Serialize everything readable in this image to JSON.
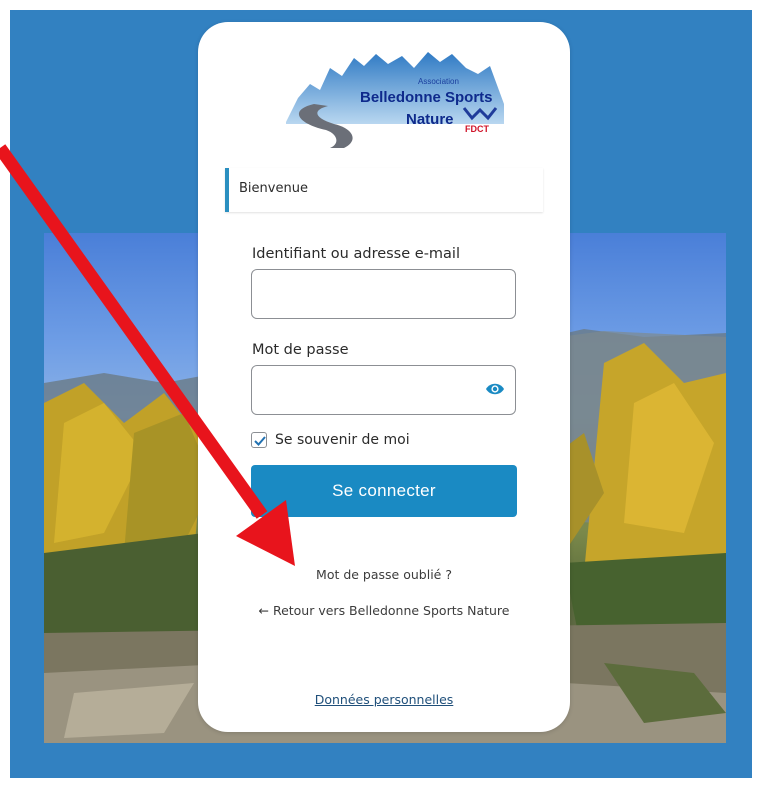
{
  "logo": {
    "line1": "Association",
    "line2": "Belledonne Sports",
    "line3": "Nature",
    "badge": "FDCT"
  },
  "notice": {
    "text": "Bienvenue"
  },
  "form": {
    "username_label": "Identifiant ou adresse e-mail",
    "username_value": "",
    "password_label": "Mot de passe",
    "password_value": "",
    "remember_label": "Se souvenir de moi",
    "remember_checked": true,
    "submit_label": "Se connecter"
  },
  "links": {
    "lost_password": "Mot de passe oublié ?",
    "back_to_site": "← Retour vers Belledonne Sports Nature",
    "privacy": "Données personnelles"
  },
  "icons": {
    "eye": "eye-icon",
    "checkmark": "checkmark-icon",
    "arrow": "annotation-arrow"
  },
  "colors": {
    "frame": "#3281c1",
    "accent": "#1a8ac3",
    "notice_border": "#2a8fc0",
    "arrow": "#e8141c"
  }
}
